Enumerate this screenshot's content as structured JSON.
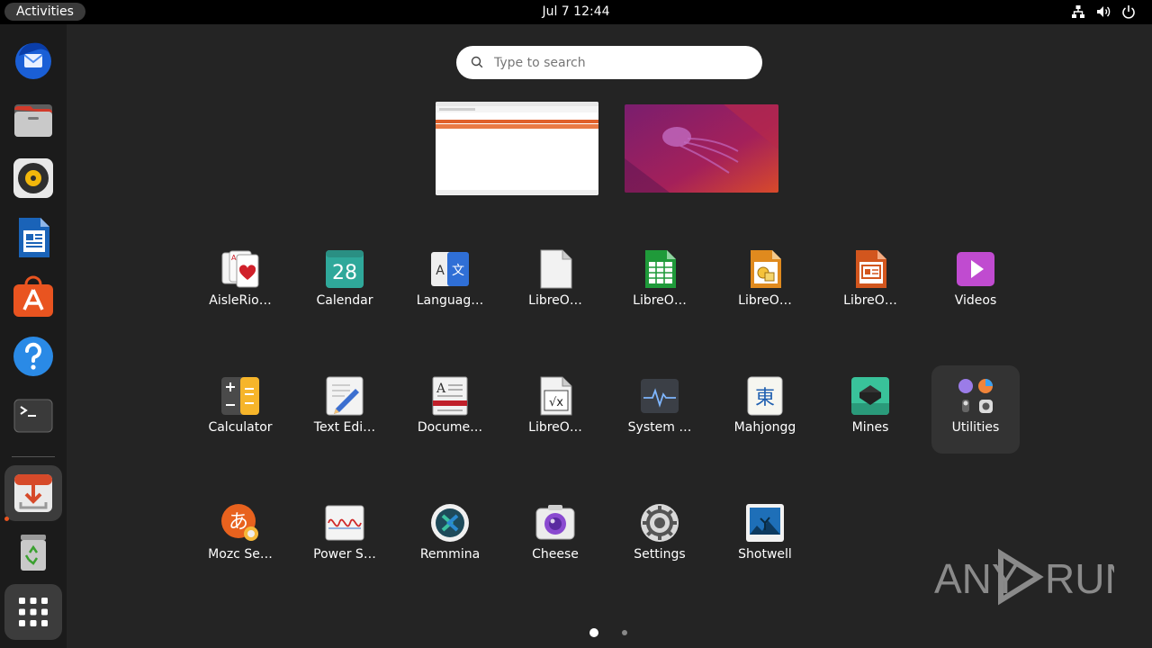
{
  "topbar": {
    "activities_label": "Activities",
    "clock": "Jul 7  12:44",
    "tray": [
      "network-icon",
      "volume-icon",
      "power-icon"
    ]
  },
  "dock": {
    "items": [
      {
        "name": "thunderbird",
        "icon": "thunderbird-icon"
      },
      {
        "name": "files",
        "icon": "files-icon"
      },
      {
        "name": "rhythmbox",
        "icon": "rhythmbox-icon"
      },
      {
        "name": "libreoffice-writer",
        "icon": "writer-icon"
      },
      {
        "name": "ubuntu-software",
        "icon": "software-icon"
      },
      {
        "name": "help",
        "icon": "help-icon"
      },
      {
        "name": "terminal",
        "icon": "terminal-icon"
      },
      {
        "name": "installer",
        "icon": "installer-icon",
        "running": true
      },
      {
        "name": "trash",
        "icon": "trash-icon"
      },
      {
        "name": "show-apps",
        "icon": "app-grid-icon",
        "active": true
      }
    ]
  },
  "search": {
    "placeholder": "Type to search"
  },
  "apps": [
    {
      "label": "AisleRio…",
      "icon": "cards-icon"
    },
    {
      "label": "Calendar",
      "icon": "calendar-icon",
      "icon_text": "28"
    },
    {
      "label": "Languag…",
      "icon": "language-icon",
      "icon_text_a": "A",
      "icon_text_b": "文"
    },
    {
      "label": "LibreO…",
      "icon": "libreoffice-icon"
    },
    {
      "label": "LibreO…",
      "icon": "calc-icon"
    },
    {
      "label": "LibreO…",
      "icon": "draw-icon"
    },
    {
      "label": "LibreO…",
      "icon": "impress-icon"
    },
    {
      "label": "Videos",
      "icon": "videos-icon"
    },
    {
      "label": "Calculator",
      "icon": "calculator-icon"
    },
    {
      "label": "Text Edi…",
      "icon": "text-editor-icon"
    },
    {
      "label": "Docume…",
      "icon": "document-viewer-icon",
      "icon_text": "A"
    },
    {
      "label": "LibreO…",
      "icon": "math-icon",
      "icon_text": "√x"
    },
    {
      "label": "System …",
      "icon": "system-monitor-icon"
    },
    {
      "label": "Mahjongg",
      "icon": "mahjongg-icon",
      "icon_text": "東"
    },
    {
      "label": "Mines",
      "icon": "mines-icon"
    },
    {
      "label": "Utilities",
      "icon": "utilities-folder-icon"
    },
    {
      "label": "Mozc Se…",
      "icon": "mozc-icon",
      "icon_text": "あ"
    },
    {
      "label": "Power S…",
      "icon": "power-statistics-icon"
    },
    {
      "label": "Remmina",
      "icon": "remmina-icon"
    },
    {
      "label": "Cheese",
      "icon": "cheese-icon"
    },
    {
      "label": "Settings",
      "icon": "settings-icon"
    },
    {
      "label": "Shotwell",
      "icon": "shotwell-icon"
    }
  ],
  "pagination": {
    "pages": 2,
    "current": 1
  },
  "watermark": {
    "text": "ANY RUN"
  }
}
